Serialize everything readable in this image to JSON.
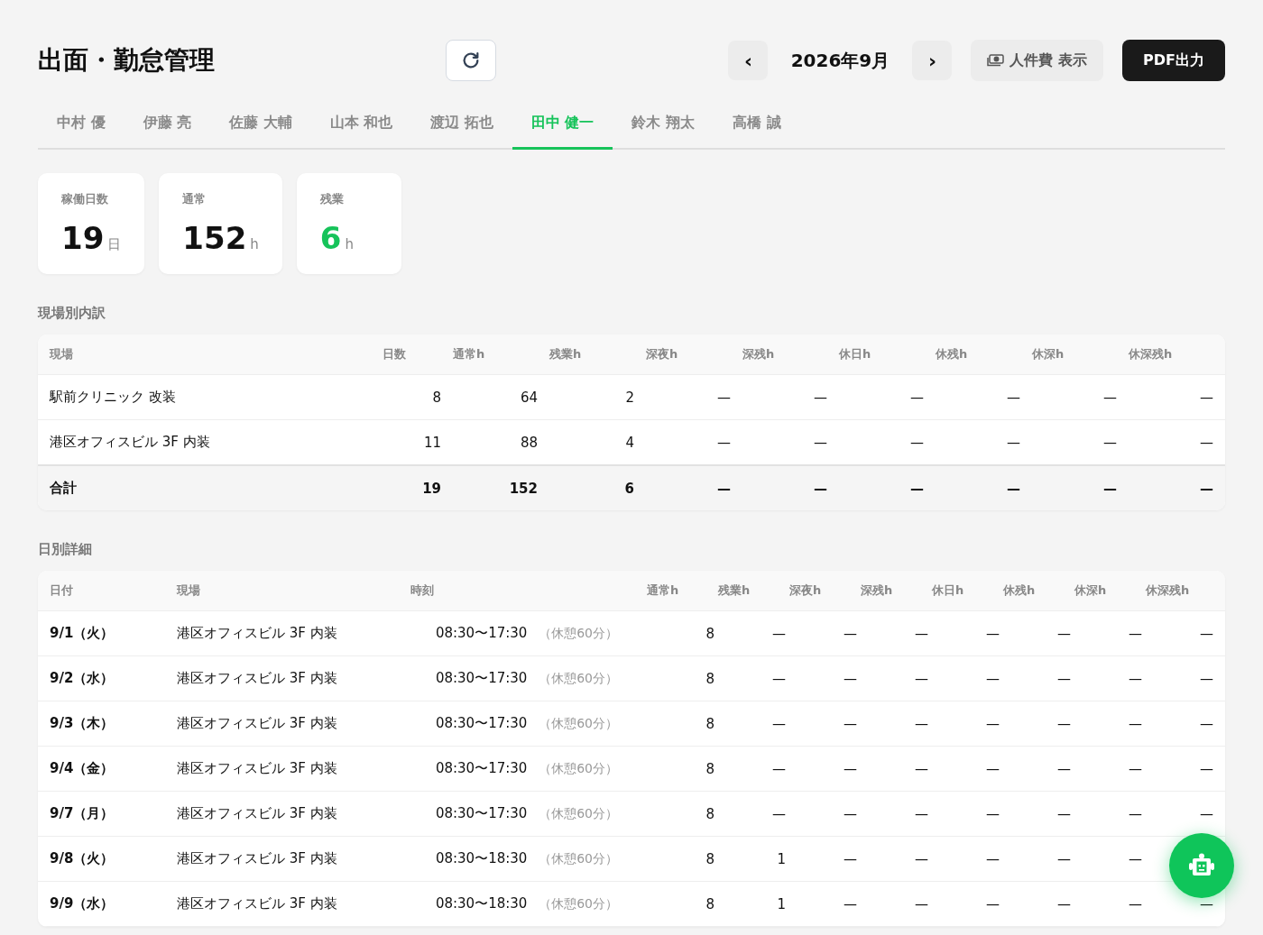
{
  "header": {
    "title": "出面・勤怠管理",
    "month": "2026年9月",
    "prev": "‹",
    "next": "›",
    "cost_toggle": "人件費 表示",
    "pdf_button": "PDF出力"
  },
  "tabs": [
    {
      "label": "中村 優",
      "selected": false
    },
    {
      "label": "伊藤 亮",
      "selected": false
    },
    {
      "label": "佐藤 大輔",
      "selected": false
    },
    {
      "label": "山本 和也",
      "selected": false
    },
    {
      "label": "渡辺 拓也",
      "selected": false
    },
    {
      "label": "田中 健一",
      "selected": true
    },
    {
      "label": "鈴木 翔太",
      "selected": false
    },
    {
      "label": "高橋 誠",
      "selected": false
    }
  ],
  "stats": [
    {
      "label": "稼働日数",
      "value": "19",
      "unit": "日",
      "color": "#111111"
    },
    {
      "label": "通常",
      "value": "152",
      "unit": "h",
      "color": "#111111"
    },
    {
      "label": "残業",
      "value": "6",
      "unit": "h",
      "color": "#16c35a"
    }
  ],
  "site_breakdown": {
    "title": "現場別内訳",
    "columns": [
      "現場",
      "日数",
      "通常h",
      "残業h",
      "深夜h",
      "深残h",
      "休日h",
      "休残h",
      "休深h",
      "休深残h"
    ],
    "rows": [
      [
        "駅前クリニック 改装",
        "8",
        "64",
        "2",
        "—",
        "—",
        "—",
        "—",
        "—",
        "—"
      ],
      [
        "港区オフィスビル 3F 内装",
        "11",
        "88",
        "4",
        "—",
        "—",
        "—",
        "—",
        "—",
        "—"
      ]
    ],
    "total": [
      "合計",
      "19",
      "152",
      "6",
      "—",
      "—",
      "—",
      "—",
      "—",
      "—"
    ]
  },
  "daily": {
    "title": "日別詳細",
    "columns": [
      "日付",
      "現場",
      "時刻",
      "通常h",
      "残業h",
      "深夜h",
      "深残h",
      "休日h",
      "休残h",
      "休深h",
      "休深残h"
    ],
    "rows": [
      {
        "date": "9/1（火）",
        "site": "港区オフィスビル 3F 内装",
        "time": "08:30〜17:30",
        "break": "（休憩60分）",
        "hours": [
          "8",
          "—",
          "—",
          "—",
          "—",
          "—",
          "—",
          "—"
        ]
      },
      {
        "date": "9/2（水）",
        "site": "港区オフィスビル 3F 内装",
        "time": "08:30〜17:30",
        "break": "（休憩60分）",
        "hours": [
          "8",
          "—",
          "—",
          "—",
          "—",
          "—",
          "—",
          "—"
        ]
      },
      {
        "date": "9/3（木）",
        "site": "港区オフィスビル 3F 内装",
        "time": "08:30〜17:30",
        "break": "（休憩60分）",
        "hours": [
          "8",
          "—",
          "—",
          "—",
          "—",
          "—",
          "—",
          "—"
        ]
      },
      {
        "date": "9/4（金）",
        "site": "港区オフィスビル 3F 内装",
        "time": "08:30〜17:30",
        "break": "（休憩60分）",
        "hours": [
          "8",
          "—",
          "—",
          "—",
          "—",
          "—",
          "—",
          "—"
        ]
      },
      {
        "date": "9/7（月）",
        "site": "港区オフィスビル 3F 内装",
        "time": "08:30〜17:30",
        "break": "（休憩60分）",
        "hours": [
          "8",
          "—",
          "—",
          "—",
          "—",
          "—",
          "—",
          "—"
        ]
      },
      {
        "date": "9/8（火）",
        "site": "港区オフィスビル 3F 内装",
        "time": "08:30〜18:30",
        "break": "（休憩60分）",
        "hours": [
          "8",
          "1",
          "—",
          "—",
          "—",
          "—",
          "—"
        ]
      },
      {
        "date": "9/9（水）",
        "site": "港区オフィスビル 3F 内装",
        "time": "08:30〜18:30",
        "break": "（休憩60分）",
        "hours": [
          "8",
          "1",
          "—",
          "—",
          "—",
          "—",
          "—",
          "—"
        ]
      }
    ]
  }
}
